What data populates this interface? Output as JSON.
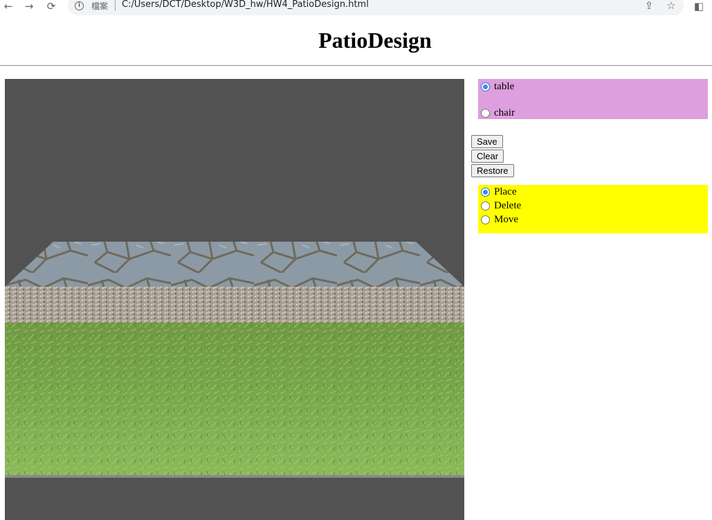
{
  "browser": {
    "scheme_label": "檔案",
    "url": "C:/Users/DCT/Desktop/W3D_hw/HW4_PatioDesign.html",
    "back_icon": "←",
    "forward_icon": "→",
    "reload_icon": "⟳",
    "share_icon": "⇪",
    "star_icon": "☆",
    "sidepanel_icon": "◧",
    "info_icon": "i"
  },
  "page": {
    "title": "PatioDesign"
  },
  "furniture": {
    "options": [
      {
        "label": "table",
        "checked": true
      },
      {
        "label": "chair",
        "checked": false
      }
    ],
    "color": "#dd9fdd"
  },
  "actions": {
    "save": "Save",
    "clear": "Clear",
    "restore": "Restore"
  },
  "mode": {
    "options": [
      {
        "label": "Place",
        "checked": true
      },
      {
        "label": "Delete",
        "checked": false
      },
      {
        "label": "Move",
        "checked": false
      }
    ],
    "color": "#ffff00"
  },
  "scene": {
    "background": "#525252",
    "surfaces": [
      "flagstone-patio",
      "gravel-strip",
      "grass-lawn"
    ]
  }
}
